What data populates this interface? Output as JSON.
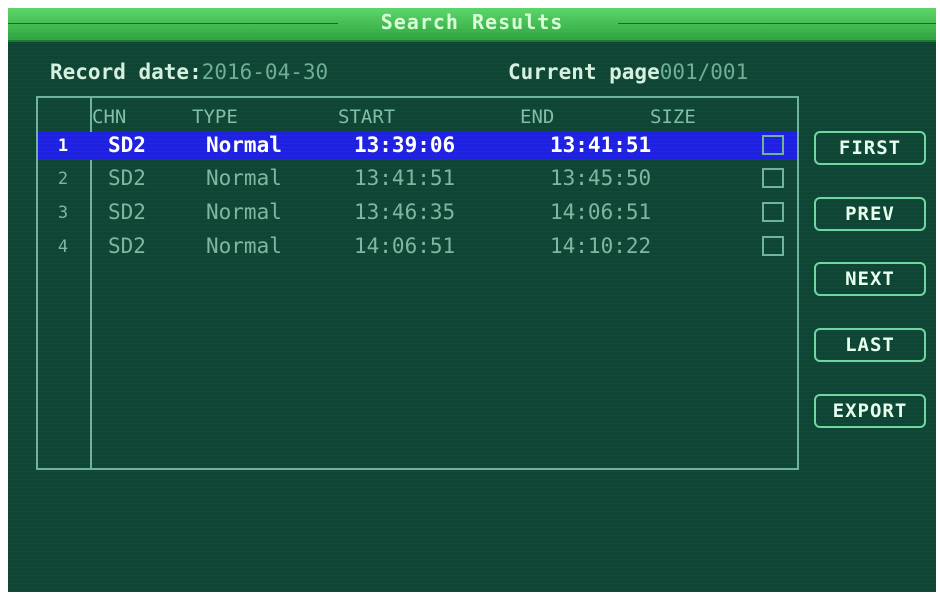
{
  "window": {
    "title": "Search Results"
  },
  "info": {
    "record_date_label": "Record date:",
    "record_date_value": "2016-04-30",
    "current_page_label": "Current page",
    "current_page_value": "001/001"
  },
  "table": {
    "headers": {
      "chn": "CHN",
      "type": "TYPE",
      "start": "START",
      "end": "END",
      "size": "SIZE"
    },
    "rows": [
      {
        "num": "1",
        "chn": "SD2",
        "type": "Normal",
        "start": "13:39:06",
        "end": "13:41:51",
        "selected": true
      },
      {
        "num": "2",
        "chn": "SD2",
        "type": "Normal",
        "start": "13:41:51",
        "end": "13:45:50",
        "selected": false
      },
      {
        "num": "3",
        "chn": "SD2",
        "type": "Normal",
        "start": "13:46:35",
        "end": "14:06:51",
        "selected": false
      },
      {
        "num": "4",
        "chn": "SD2",
        "type": "Normal",
        "start": "14:06:51",
        "end": "14:10:22",
        "selected": false
      }
    ]
  },
  "buttons": {
    "first": "FIRST",
    "prev": "PREV",
    "next": "NEXT",
    "last": "LAST",
    "export": "EXPORT"
  },
  "colors": {
    "background": "#0f4534",
    "title_bar": "#3cbf4e",
    "selected_row": "#1e22e0",
    "border": "#6fb39c"
  }
}
